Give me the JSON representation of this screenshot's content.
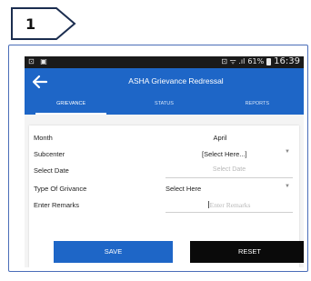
{
  "step": {
    "number": "1"
  },
  "status_bar": {
    "left_icons": "⊡ ▣",
    "right_icons": "⊡ ᯤ .ıl",
    "battery": "61%",
    "time": "16:39"
  },
  "app_bar": {
    "title": "ASHA Grievance Redressal",
    "back_icon": "arrow-back-icon"
  },
  "tabs": [
    {
      "label": "GRIEVANCE",
      "active": true
    },
    {
      "label": "STATUS",
      "active": false
    },
    {
      "label": "REPORTS",
      "active": false
    }
  ],
  "form": {
    "month": {
      "label": "Month",
      "value": "April"
    },
    "subcenter": {
      "label": "Subcenter",
      "value": "[Select Here...]"
    },
    "date": {
      "label": "Select Date",
      "placeholder": "Select Date"
    },
    "type": {
      "label": "Type Of Grivance",
      "value": "Select Here"
    },
    "remarks": {
      "label": "Enter Remarks",
      "placeholder": "Enter Remarks"
    },
    "save_label": "SAVE",
    "reset_label": "RESET"
  },
  "colors": {
    "primary": "#1e66c7",
    "status_bar": "#1a1a1a",
    "reset": "#0a0a0a",
    "frame": "#4a6db8"
  }
}
